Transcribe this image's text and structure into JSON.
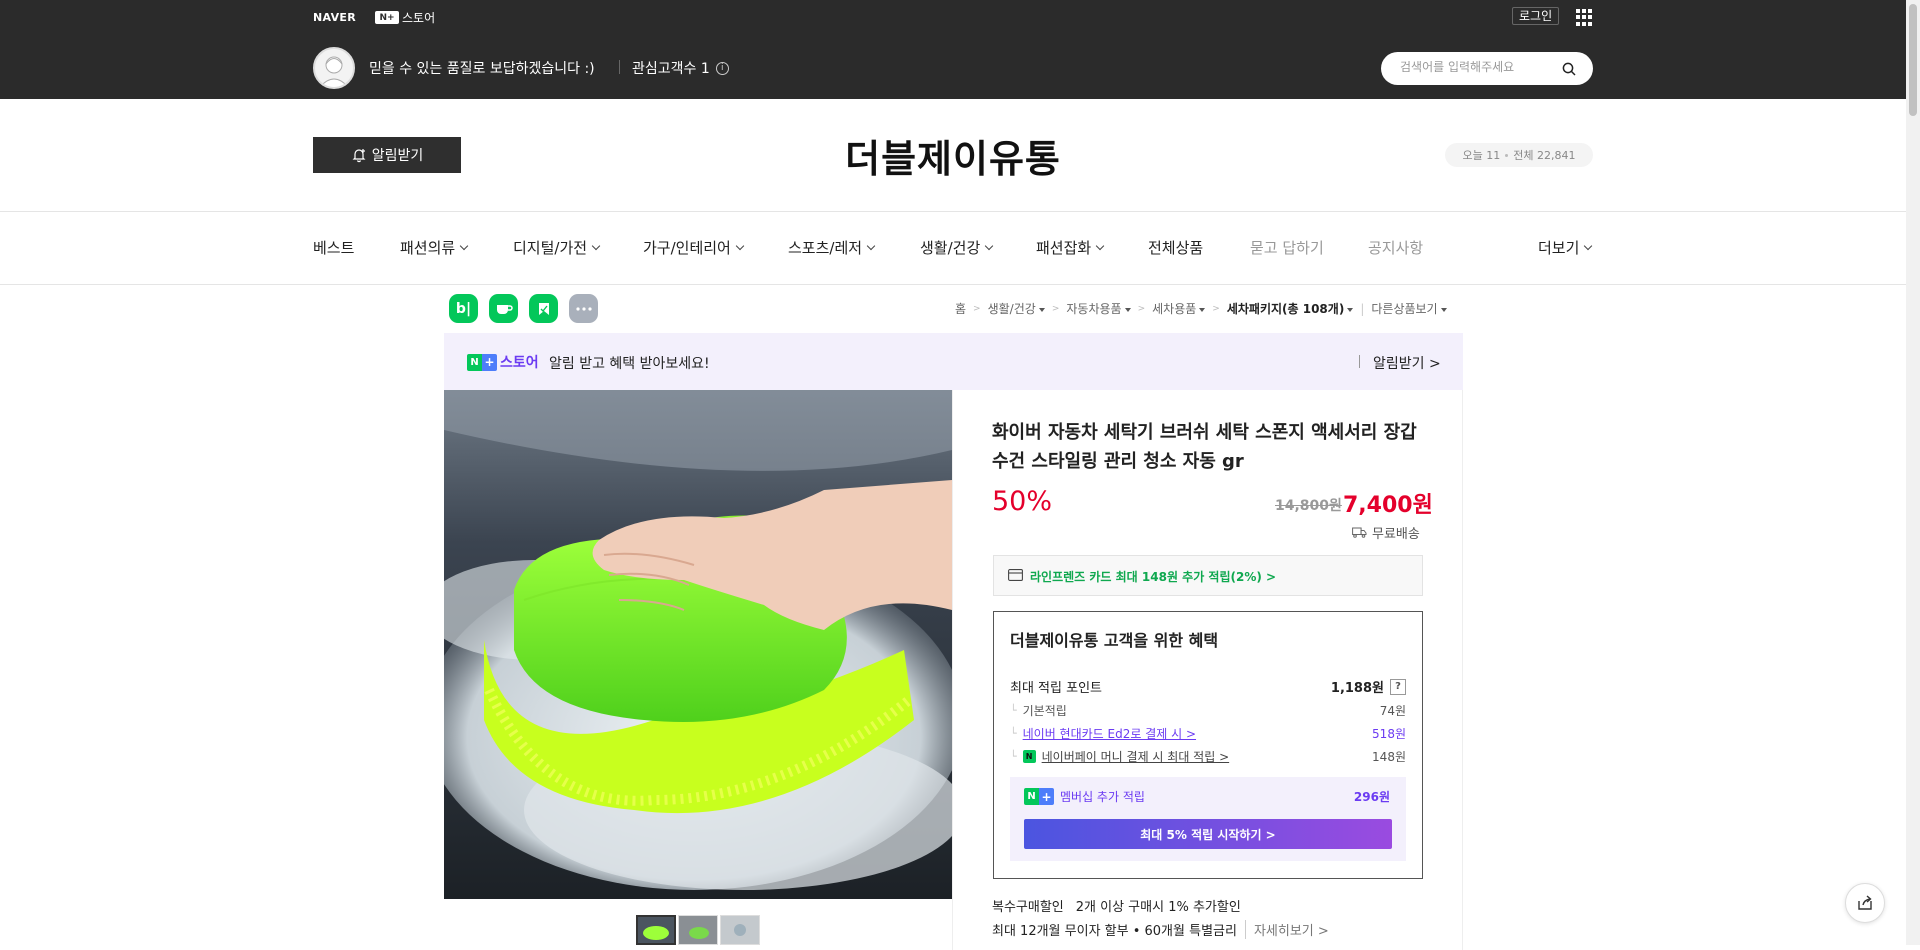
{
  "topbar": {
    "naver_logo": "NAVER",
    "nplus_box": "N+",
    "nplus_label": "스토어",
    "login": "로그인",
    "store_desc": "믿을 수 있는 품질로 보답하겠습니다 :)",
    "fans": "관심고객수 1",
    "search_placeholder": "검색어를 입력해주세요"
  },
  "header": {
    "notify_button": "알림받기",
    "store_name": "더블제이유통",
    "visitors_today": "오늘 11",
    "visitors_total": "전체 22,841"
  },
  "nav": {
    "items": [
      {
        "label": "베스트"
      },
      {
        "label": "패션의류"
      },
      {
        "label": "디지털/가전"
      },
      {
        "label": "가구/인테리어"
      },
      {
        "label": "스포츠/레저"
      },
      {
        "label": "생활/건강"
      },
      {
        "label": "패션잡화"
      },
      {
        "label": "전체상품"
      },
      {
        "label": "묻고 답하기"
      },
      {
        "label": "공지사항"
      },
      {
        "label": "더보기"
      }
    ]
  },
  "breadcrumb": {
    "home": "홈",
    "c1": "생활/건강",
    "c2": "자동차용품",
    "c3": "세차용품",
    "c4": "세차패키지(총 108개)",
    "other": "다른상품보기"
  },
  "promo": {
    "logo_label": "스토어",
    "text": "알림 받고 혜택 받아보세요!",
    "link": "알림받기 >"
  },
  "product": {
    "title": "화이버 자동차 세탁기 브러쉬 세탁 스폰지 액세서리 장갑 수건 스타일링 관리 청소 자동 gr",
    "discount": "50%",
    "original_price": "14,800원",
    "sale_price": "7,400원",
    "shipping": "무료배송",
    "card_benefit": "라인프렌즈 카드 최대 148원 추가 적립(2%) >"
  },
  "benefit": {
    "title": "더블제이유통 고객을 위한 혜택",
    "max_points_label": "최대 적립 포인트",
    "max_points_value": "1,188원",
    "help": "?",
    "basic_label": "기본적립",
    "basic_value": "74원",
    "card_label": "네이버 현대카드 Ed2로 결제 시 >",
    "card_value": "518원",
    "npay_label": "네이버페이 머니 결제 시 최대 적립 >",
    "npay_value": "148원",
    "npay_icon": "N",
    "membership_label": "멤버십 추가 적립",
    "membership_value": "296원",
    "membership_button": "최대 5% 적립 시작하기 >"
  },
  "extra": {
    "bulk_label": "복수구매할인",
    "bulk_text": "2개 이상 구매시 1% 추가할인",
    "installment": "최대 12개월 무이자 할부 • 60개월 특별금리",
    "installment_more": "자세히보기 >"
  },
  "colors": {
    "accent_red": "#e4002b",
    "naver_green": "#03c75a",
    "purple": "#6b3bf2"
  }
}
